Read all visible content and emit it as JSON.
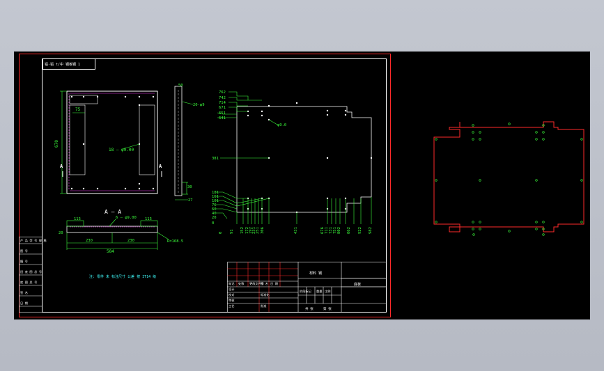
{
  "drawing": {
    "header_note": "铝-铝 t/中 钢板钢 1",
    "section_label": "A — A",
    "front_view": {
      "height_dim": "670",
      "width_dim": "75",
      "hole_callout": "18 — φ9.00",
      "arrow_left": "A",
      "arrow_right": "A"
    },
    "side_view": {
      "top_dim": "50",
      "hole_callout": "20-φ9",
      "b1": "30",
      "b2": "27"
    },
    "section_view": {
      "w_left": "115",
      "w_right": "115",
      "holes": "6 — φ9.00",
      "thickness": "20",
      "half_left": "230",
      "half_right": "230",
      "total": "584",
      "radius": "R=168.5"
    },
    "plate_view": {
      "hole_callout": "φ9.0",
      "left_dims": [
        "762",
        "742",
        "714",
        "671",
        "651",
        "641",
        "381",
        "181",
        "161",
        "101",
        "76",
        "60",
        "40",
        "20",
        "0"
      ],
      "bottom_dims": [
        "0",
        "91",
        "152",
        "172",
        "192",
        "231",
        "251",
        "306",
        "431",
        "676",
        "711",
        "731",
        "751",
        "802",
        "862",
        "922",
        "982"
      ]
    },
    "note": "注: 零件 未 标注尺寸 公差 按 IT14 级",
    "revision_table": {
      "rows": [
        "产 品 型 号 规 格",
        "图 号",
        "编 号",
        "旧 底 图 总 号",
        "底 图 总 号",
        "签 名",
        "日 期"
      ]
    },
    "title_block": {
      "material": "材料 钢",
      "part": "底板",
      "cells": [
        "标记",
        "处数",
        "更改文件号",
        "签 名",
        "日 期",
        "设计",
        "校对",
        "审核",
        "工艺",
        "标准化",
        "批准"
      ],
      "scale_row": [
        "阶段标记",
        "重量",
        "比例"
      ],
      "sheet": [
        "共 张",
        "第 张"
      ]
    }
  }
}
